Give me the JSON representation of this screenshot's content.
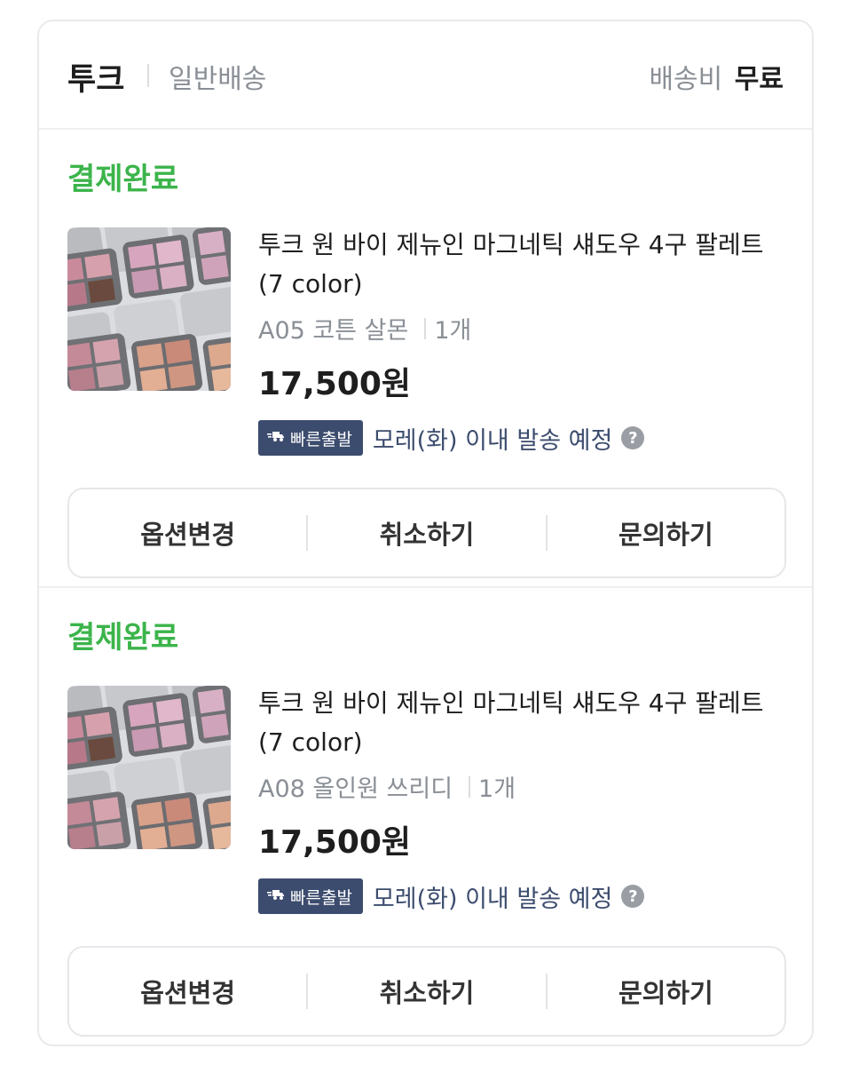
{
  "seller": {
    "name": "투크",
    "delivery_type": "일반배송",
    "shipping_label": "배송비",
    "shipping_fee": "무료"
  },
  "orders": [
    {
      "status": "결제완료",
      "product_name": "투크 원 바이 제뉴인 마그네틱 섀도우 4구 팔레트 (7 color)",
      "option": "A05 코튼 살몬",
      "quantity": "1개",
      "price": "17,500원",
      "badge": "빠른출발",
      "ship_eta": "모레(화) 이내 발송 예정",
      "help": "?",
      "actions": [
        "옵션변경",
        "취소하기",
        "문의하기"
      ]
    },
    {
      "status": "결제완료",
      "product_name": "투크 원 바이 제뉴인 마그네틱 섀도우 4구 팔레트 (7 color)",
      "option": "A08 올인원 쓰리디",
      "quantity": "1개",
      "price": "17,500원",
      "badge": "빠른출발",
      "ship_eta": "모레(화) 이내 발송 예정",
      "help": "?",
      "actions": [
        "옵션변경",
        "취소하기",
        "문의하기"
      ]
    }
  ],
  "colors": {
    "status_green": "#3cb44b",
    "badge_navy": "#3c4c6e",
    "muted_gray": "#8a8f96"
  },
  "icons": {
    "badge_icon": "fast-truck-icon",
    "help_icon": "question-circle-icon"
  }
}
